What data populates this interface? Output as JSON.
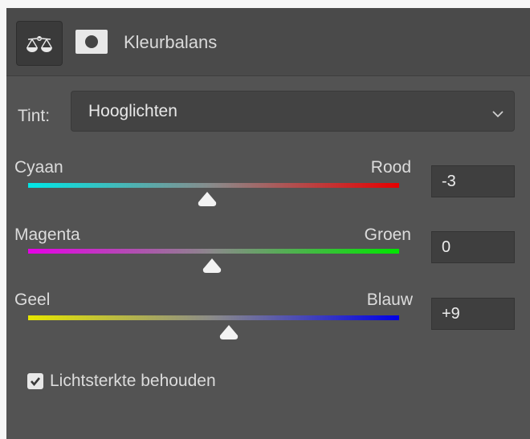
{
  "panel": {
    "title": "Kleurbalans",
    "icons": [
      "balance-scale-icon",
      "layer-mask-icon"
    ]
  },
  "tone": {
    "label": "Tint:",
    "selected": "Hooglichten"
  },
  "sliders": [
    {
      "left_label": "Cyaan",
      "right_label": "Rood",
      "value": "-3",
      "left_color": "#00e6e6",
      "right_color": "#e60000"
    },
    {
      "left_label": "Magenta",
      "right_label": "Groen",
      "value": "0",
      "left_color": "#e600e6",
      "right_color": "#00e600"
    },
    {
      "left_label": "Geel",
      "right_label": "Blauw",
      "value": "+9",
      "left_color": "#e6e600",
      "right_color": "#0000e6"
    }
  ],
  "preserve_luminosity": {
    "label": "Lichtsterkte behouden",
    "checked": true
  }
}
